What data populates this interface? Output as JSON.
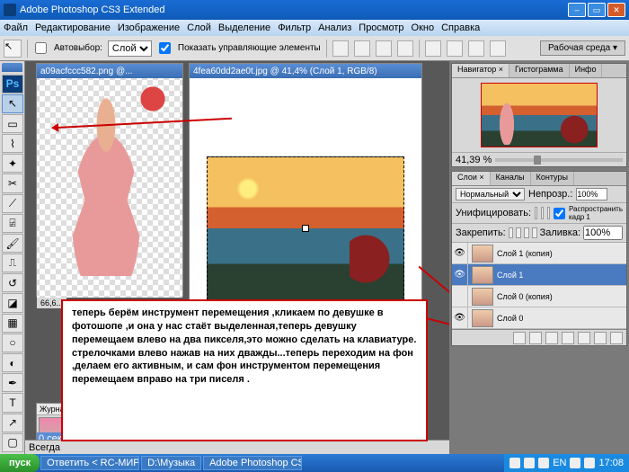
{
  "title": "Adobe Photoshop CS3 Extended",
  "menu": [
    "Файл",
    "Редактирование",
    "Изображение",
    "Слой",
    "Выделение",
    "Фильтр",
    "Анализ",
    "Просмотр",
    "Окно",
    "Справка"
  ],
  "opt": {
    "autoSelectLabel": "Автовыбор:",
    "autoSelectValue": "Слой",
    "showControlsLabel": "Показать управляющие элементы",
    "workspace": "Рабочая среда ▾"
  },
  "doc1": {
    "title": "a09acfccc582.png @...",
    "status": "66,6..."
  },
  "doc2": {
    "title": "4fea60dd2ae0t.jpg @ 41,4% (Слой 1, RGB/8)"
  },
  "note": "теперь берём инструмент перемещения ,кликаем по девушке в фотошопе ,и она у нас стаёт выделенная,теперь девушку перемещаем влево на два пикселя,это можно сделать на клавиатуре. стрелочками влево  нажав на них дважды...теперь переходим на фон ,делаем его активным, и сам фон инструментом перемещения перемещаем вправо на три писеля .",
  "nav": {
    "tabs": [
      "Навигатор ×",
      "Гистограмма",
      "Инфо"
    ],
    "zoom": "41,39 %"
  },
  "layers": {
    "tabs": [
      "Слои ×",
      "Каналы",
      "Контуры"
    ],
    "blend": "Нормальный",
    "opacityLabel": "Непрозр.:",
    "opacity": "100%",
    "unifyLabel": "Унифицировать:",
    "propagate": "Распространить кадр 1",
    "lockLabel": "Закрепить:",
    "fillLabel": "Заливка:",
    "fill": "100%",
    "items": [
      {
        "name": "Слой 1 (копия)",
        "sel": false
      },
      {
        "name": "Слой 1",
        "sel": true
      },
      {
        "name": "Слой 0 (копия)",
        "sel": false
      },
      {
        "name": "Слой 0",
        "sel": false
      }
    ]
  },
  "journal": {
    "tab": "Журна"
  },
  "status": {
    "always": "Всегда",
    "sec": "  0 сек."
  },
  "taskbar": {
    "start": "пуск",
    "btns": [
      "Ответить < RC-МИР....",
      "D:\\Музыка",
      "Adobe Photoshop CS..."
    ],
    "lang": "EN",
    "time": "17:08"
  }
}
